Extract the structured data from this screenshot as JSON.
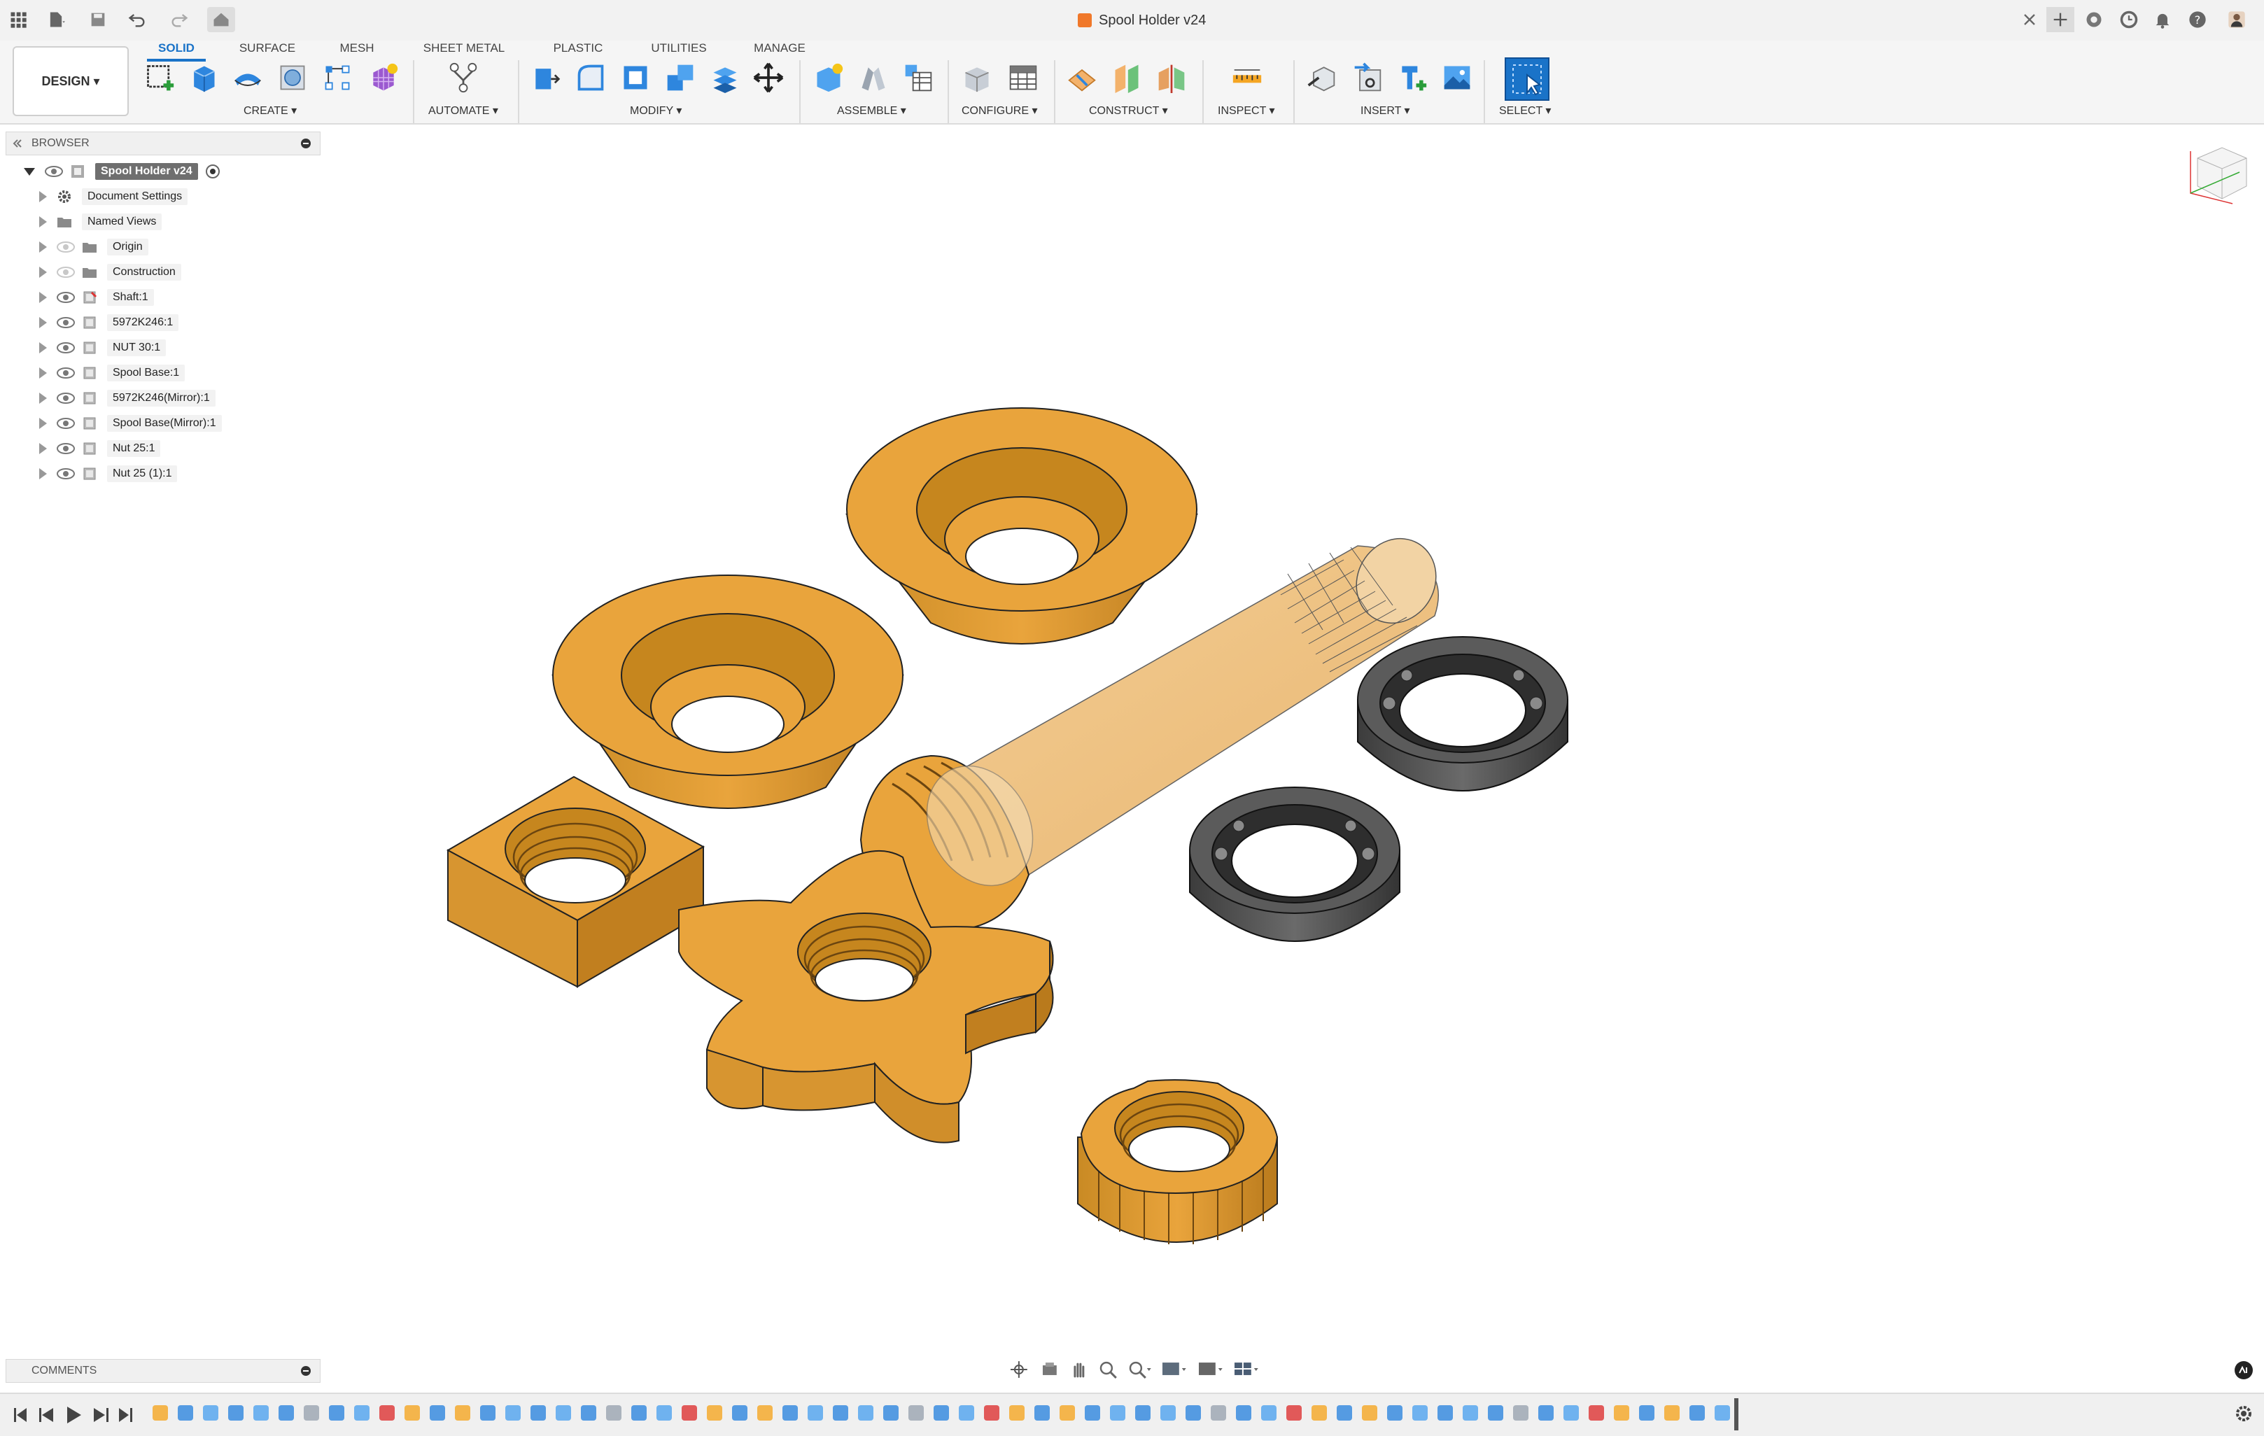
{
  "window": {
    "title": "Spool Holder v24"
  },
  "ribbon": {
    "design_label": "DESIGN ▾",
    "tabs": [
      {
        "label": "SOLID"
      },
      {
        "label": "SURFACE"
      },
      {
        "label": "MESH"
      },
      {
        "label": "SHEET METAL"
      },
      {
        "label": "PLASTIC"
      },
      {
        "label": "UTILITIES"
      },
      {
        "label": "MANAGE"
      }
    ],
    "groups": [
      {
        "label": "CREATE ▾"
      },
      {
        "label": "AUTOMATE ▾"
      },
      {
        "label": "MODIFY ▾"
      },
      {
        "label": "ASSEMBLE ▾"
      },
      {
        "label": "CONFIGURE ▾"
      },
      {
        "label": "CONSTRUCT ▾"
      },
      {
        "label": "INSPECT ▾"
      },
      {
        "label": "INSERT ▾"
      },
      {
        "label": "SELECT ▾"
      }
    ]
  },
  "browser": {
    "title": "BROWSER",
    "root": "Spool Holder v24",
    "items": [
      {
        "label": "Document Settings",
        "icon": "gear-icon"
      },
      {
        "label": "Named Views",
        "icon": "folder-icon"
      },
      {
        "label": "Origin",
        "icon": "folder-icon"
      },
      {
        "label": "Construction",
        "icon": "folder-icon"
      },
      {
        "label": "Shaft:1",
        "icon": "component-icon"
      },
      {
        "label": "5972K246:1",
        "icon": "component-icon"
      },
      {
        "label": "NUT 30:1",
        "icon": "component-icon"
      },
      {
        "label": "Spool Base:1",
        "icon": "component-icon"
      },
      {
        "label": "5972K246(Mirror):1",
        "icon": "component-icon"
      },
      {
        "label": "Spool Base(Mirror):1",
        "icon": "component-icon"
      },
      {
        "label": "Nut 25:1",
        "icon": "component-icon"
      },
      {
        "label": "Nut 25 (1):1",
        "icon": "component-icon"
      }
    ]
  },
  "comments": {
    "title": "COMMENTS"
  },
  "colors": {
    "accent": "#1a73c8",
    "part": "#e9a43c",
    "bearing": "#4a4a4a"
  }
}
